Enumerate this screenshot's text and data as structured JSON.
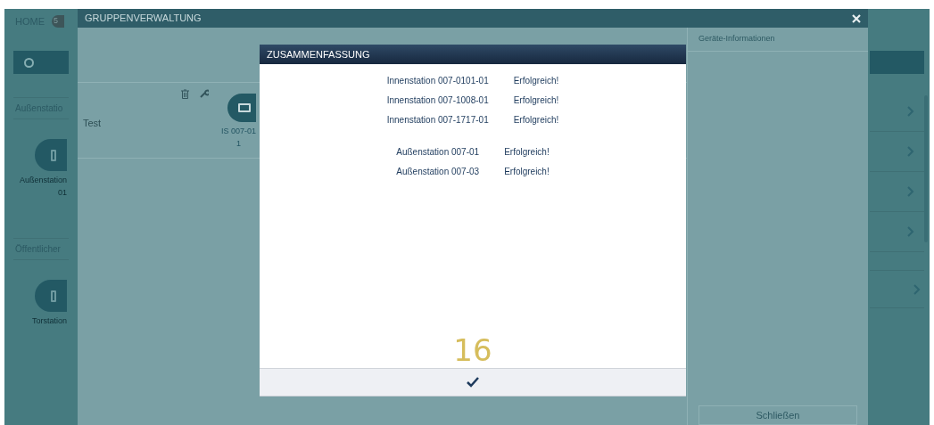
{
  "background_app": {
    "home": "HOME",
    "badge": "5",
    "sections": [
      {
        "title": "Außenstatio",
        "devices": [
          {
            "lines": [
              "Außenstation",
              "01"
            ]
          }
        ]
      },
      {
        "title": "Öffentlicher",
        "devices": [
          {
            "lines": [
              "Torstation"
            ]
          }
        ]
      }
    ]
  },
  "window": {
    "title": "GRUPPENVERWALTUNG",
    "groups": [
      {
        "name": "Test",
        "devices": [
          {
            "lines": [
              "IS 007-01",
              "1"
            ]
          }
        ]
      }
    ],
    "info_panel": {
      "title": "Geräte-Informationen",
      "close_button": "Schließen"
    }
  },
  "dialog": {
    "title": "ZUSAMMENFASSUNG",
    "groups": [
      [
        {
          "name": "Innenstation 007-0101-01",
          "status": "Erfolgreich!"
        },
        {
          "name": "Innenstation 007-1008-01",
          "status": "Erfolgreich!"
        },
        {
          "name": "Innenstation 007-1717-01",
          "status": "Erfolgreich!"
        }
      ],
      [
        {
          "name": "Außenstation 007-01",
          "status": "Erfolgreich!"
        },
        {
          "name": "Außenstation 007-03",
          "status": "Erfolgreich!"
        }
      ]
    ],
    "countdown": "16"
  }
}
